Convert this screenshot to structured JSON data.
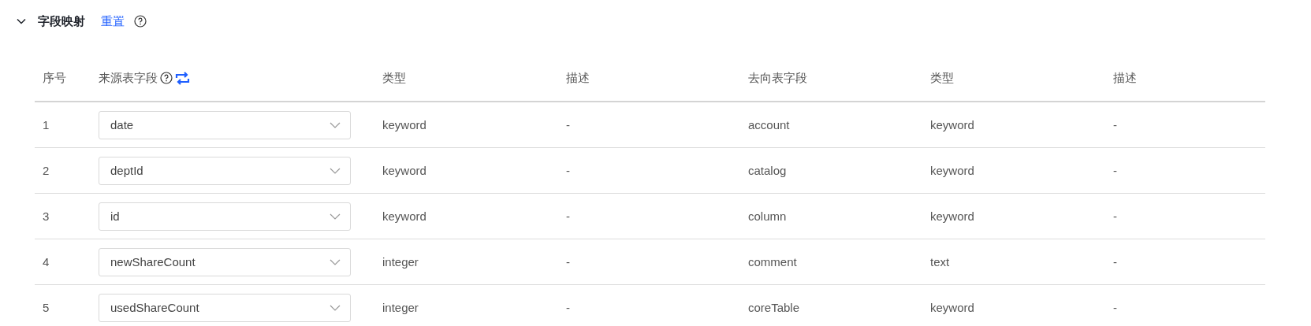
{
  "section": {
    "title": "字段映射",
    "expanded": true,
    "reset_link": "重置"
  },
  "table": {
    "columns": [
      "序号",
      "来源表字段",
      "类型",
      "描述",
      "去向表字段",
      "类型",
      "描述"
    ],
    "rows": [
      {
        "index": "1",
        "source_field": "date",
        "source_type": "keyword",
        "source_desc": "-",
        "target_field": "account",
        "target_type": "keyword",
        "target_desc": "-"
      },
      {
        "index": "2",
        "source_field": "deptId",
        "source_type": "keyword",
        "source_desc": "-",
        "target_field": "catalog",
        "target_type": "keyword",
        "target_desc": "-"
      },
      {
        "index": "3",
        "source_field": "id",
        "source_type": "keyword",
        "source_desc": "-",
        "target_field": "column",
        "target_type": "keyword",
        "target_desc": "-"
      },
      {
        "index": "4",
        "source_field": "newShareCount",
        "source_type": "integer",
        "source_desc": "-",
        "target_field": "comment",
        "target_type": "text",
        "target_desc": "-"
      },
      {
        "index": "5",
        "source_field": "usedShareCount",
        "source_type": "integer",
        "source_desc": "-",
        "target_field": "coreTable",
        "target_type": "keyword",
        "target_desc": "-"
      }
    ]
  }
}
